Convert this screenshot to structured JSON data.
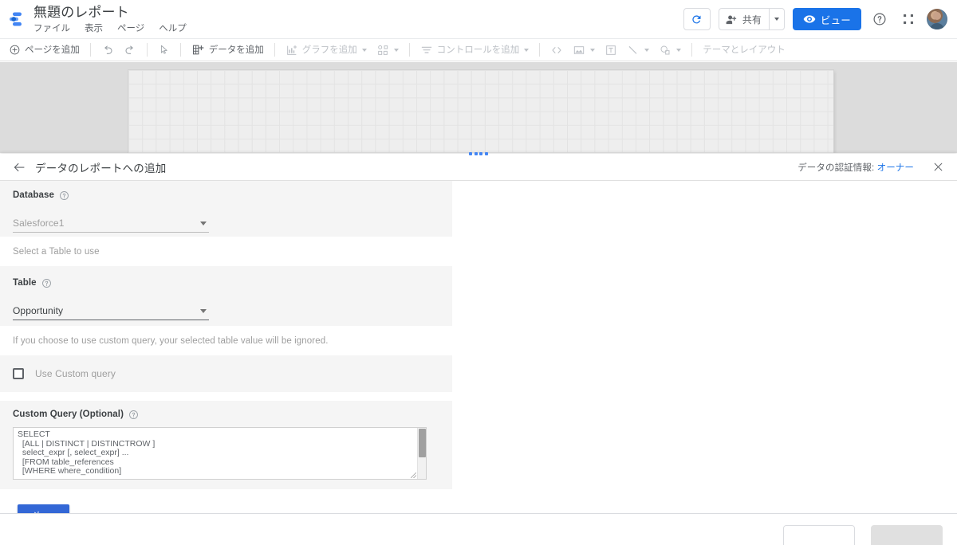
{
  "appbar": {
    "logo_icon": "looker-studio-logo-icon",
    "doc_title": "無題のレポート",
    "menus": [
      {
        "label": "ファイル",
        "name": "menu-file"
      },
      {
        "label": "表示",
        "name": "menu-view"
      },
      {
        "label": "ページ",
        "name": "menu-page"
      },
      {
        "label": "ヘルプ",
        "name": "menu-help"
      }
    ],
    "refresh_icon": "refresh-icon",
    "share_label": "共有",
    "share_icon": "person-add-icon",
    "share_caret_icon": "chevron-down-icon",
    "view_label": "ビュー",
    "view_icon": "eye-icon",
    "help_icon": "help-circle-icon",
    "apps_icon": "apps-grid-icon",
    "avatar_icon": "user-avatar"
  },
  "toolbar": {
    "add_page": "ページを追加",
    "add_page_icon": "plus-circle-icon",
    "undo_icon": "undo-icon",
    "redo_icon": "redo-icon",
    "select_icon": "cursor-arrow-icon",
    "add_data": "データを追加",
    "add_data_icon": "add-data-icon",
    "add_chart": "グラフを追加",
    "add_chart_icon": "bar-chart-add-icon",
    "community_viz_icon": "community-visualization-icon",
    "add_control": "コントロールを追加",
    "add_control_icon": "filter-control-icon",
    "embed_icon": "embed-code-icon",
    "image_icon": "image-icon",
    "text_icon": "text-box-icon",
    "line_icon": "line-icon",
    "shape_icon": "shape-icon",
    "theme_layout": "テーマとレイアウト"
  },
  "panel": {
    "back_icon": "back-arrow-icon",
    "title": "データのレポートへの追加",
    "credentials_prefix": "データの認証情報: ",
    "credentials_value": "オーナー",
    "close_icon": "close-icon"
  },
  "form": {
    "database": {
      "label": "Database",
      "help_icon": "help-circle-icon",
      "value": "Salesforce1",
      "caret_icon": "dropdown-caret-icon"
    },
    "select_table_hint": "Select a Table to use",
    "table": {
      "label": "Table",
      "help_icon": "help-circle-icon",
      "value": "Opportunity",
      "caret_icon": "dropdown-caret-icon"
    },
    "custom_query_hint": "If you choose to use custom query, your selected table value will be ignored.",
    "use_custom_query": {
      "label": "Use Custom query",
      "checked": false,
      "checkbox_icon": "checkbox-unchecked-icon"
    },
    "custom_query": {
      "label": "Custom Query (Optional)",
      "help_icon": "help-circle-icon",
      "value": "SELECT\n  [ALL | DISTINCT | DISTINCTROW ]\n  select_expr [, select_expr] ...\n  [FROM table_references\n  [WHERE where_condition]",
      "scrollbar_icon": "vertical-scrollbar",
      "resize_icon": "resize-handle-icon"
    },
    "next_button": "次へ"
  },
  "footer": {
    "cancel_label": "",
    "add_label": ""
  },
  "colors": {
    "accent_blue": "#1a73e8",
    "next_blue": "#3367d6",
    "link_blue": "#1a73e8",
    "text_primary": "#3c4043",
    "text_secondary": "#5f6368",
    "text_muted": "#9e9e9e",
    "card_bg": "#f5f5f5",
    "canvas_bg": "#dcdcdc",
    "page_bg": "#eeeeee"
  }
}
